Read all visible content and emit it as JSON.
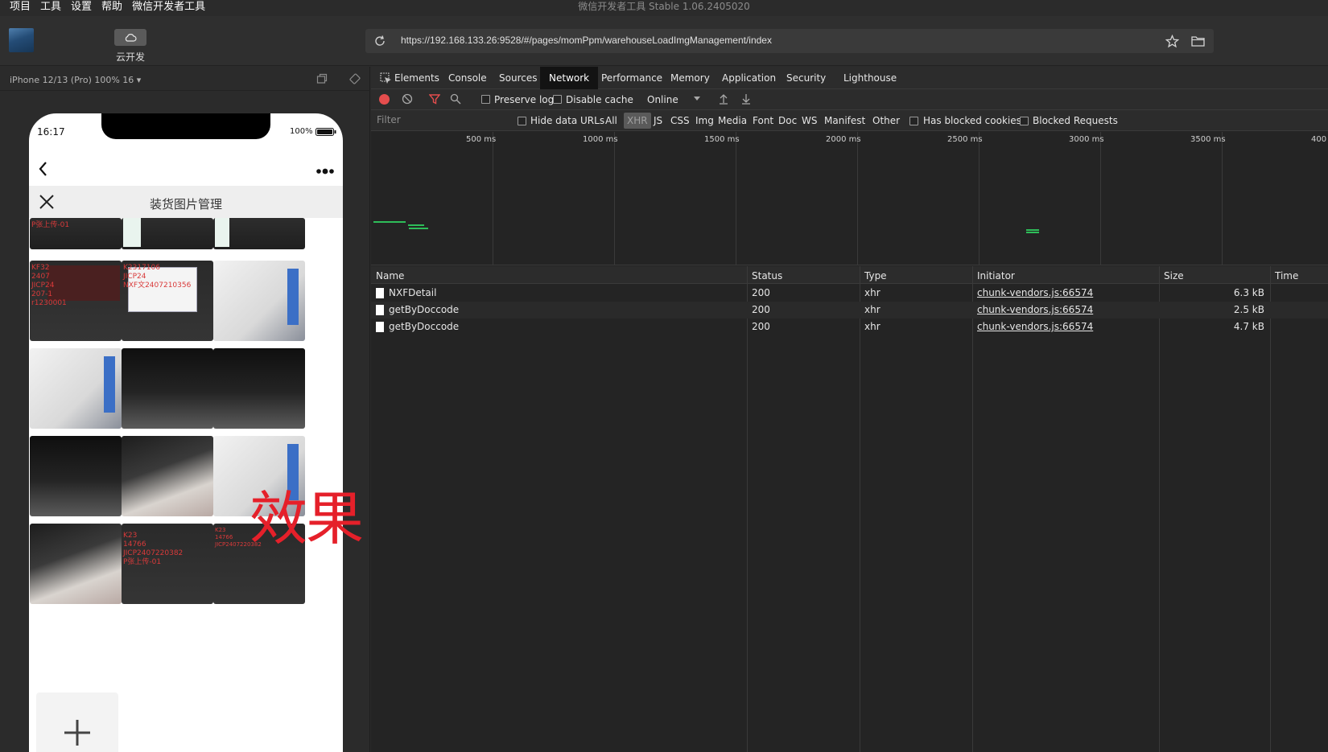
{
  "menubar": {
    "items": [
      "项目",
      "工具",
      "设置",
      "帮助",
      "微信开发者工具"
    ],
    "title": "微信开发者工具 Stable 1.06.2405020"
  },
  "toolbar": {
    "cloud_label": "云开发",
    "url": "https://192.168.133.26:9528/#/pages/momPpm/warehouseLoadImgManagement/index"
  },
  "simulator": {
    "device_label": "iPhone 12/13 (Pro) 100% 16 ▾",
    "status_time": "16:17",
    "battery": "100%",
    "page_title": "装货图片管理",
    "overlay_text": "效果",
    "thumb_texts": {
      "r0c0": "P张上传-01",
      "r1c0": "KF32\n2407\nJICP24\n207-1\nr1230001",
      "r1c1": "K2317106\nJICP24\nNXF文2407210356",
      "r4c1": "K23\n14766\nJICP2407220382\nP张上传-01",
      "r4c2": "K23\n14766\nJICP2407220382"
    }
  },
  "devtools": {
    "tabs": [
      "Elements",
      "Console",
      "Sources",
      "Network",
      "Performance",
      "Memory",
      "Application",
      "Security",
      "Lighthouse"
    ],
    "active_tab": "Network",
    "toolbar": {
      "preserve_log": "Preserve log",
      "disable_cache": "Disable cache",
      "throttle": "Online"
    },
    "filter": {
      "placeholder": "Filter",
      "hide_data_urls": "Hide data URLs",
      "types": [
        "All",
        "XHR",
        "JS",
        "CSS",
        "Img",
        "Media",
        "Font",
        "Doc",
        "WS",
        "Manifest",
        "Other"
      ],
      "selected_type": "XHR",
      "has_blocked_cookies": "Has blocked cookies",
      "blocked_requests": "Blocked Requests"
    },
    "overview_ticks": [
      "500 ms",
      "1000 ms",
      "1500 ms",
      "2000 ms",
      "2500 ms",
      "3000 ms",
      "3500 ms",
      "400"
    ],
    "columns": [
      "Name",
      "Status",
      "Type",
      "Initiator",
      "Size",
      "Time"
    ],
    "rows": [
      {
        "name": "NXFDetail",
        "status": "200",
        "type": "xhr",
        "initiator": "chunk-vendors.js:66574",
        "size": "6.3 kB"
      },
      {
        "name": "getByDoccode",
        "status": "200",
        "type": "xhr",
        "initiator": "chunk-vendors.js:66574",
        "size": "2.5 kB"
      },
      {
        "name": "getByDoccode",
        "status": "200",
        "type": "xhr",
        "initiator": "chunk-vendors.js:66574",
        "size": "4.7 kB"
      }
    ]
  }
}
